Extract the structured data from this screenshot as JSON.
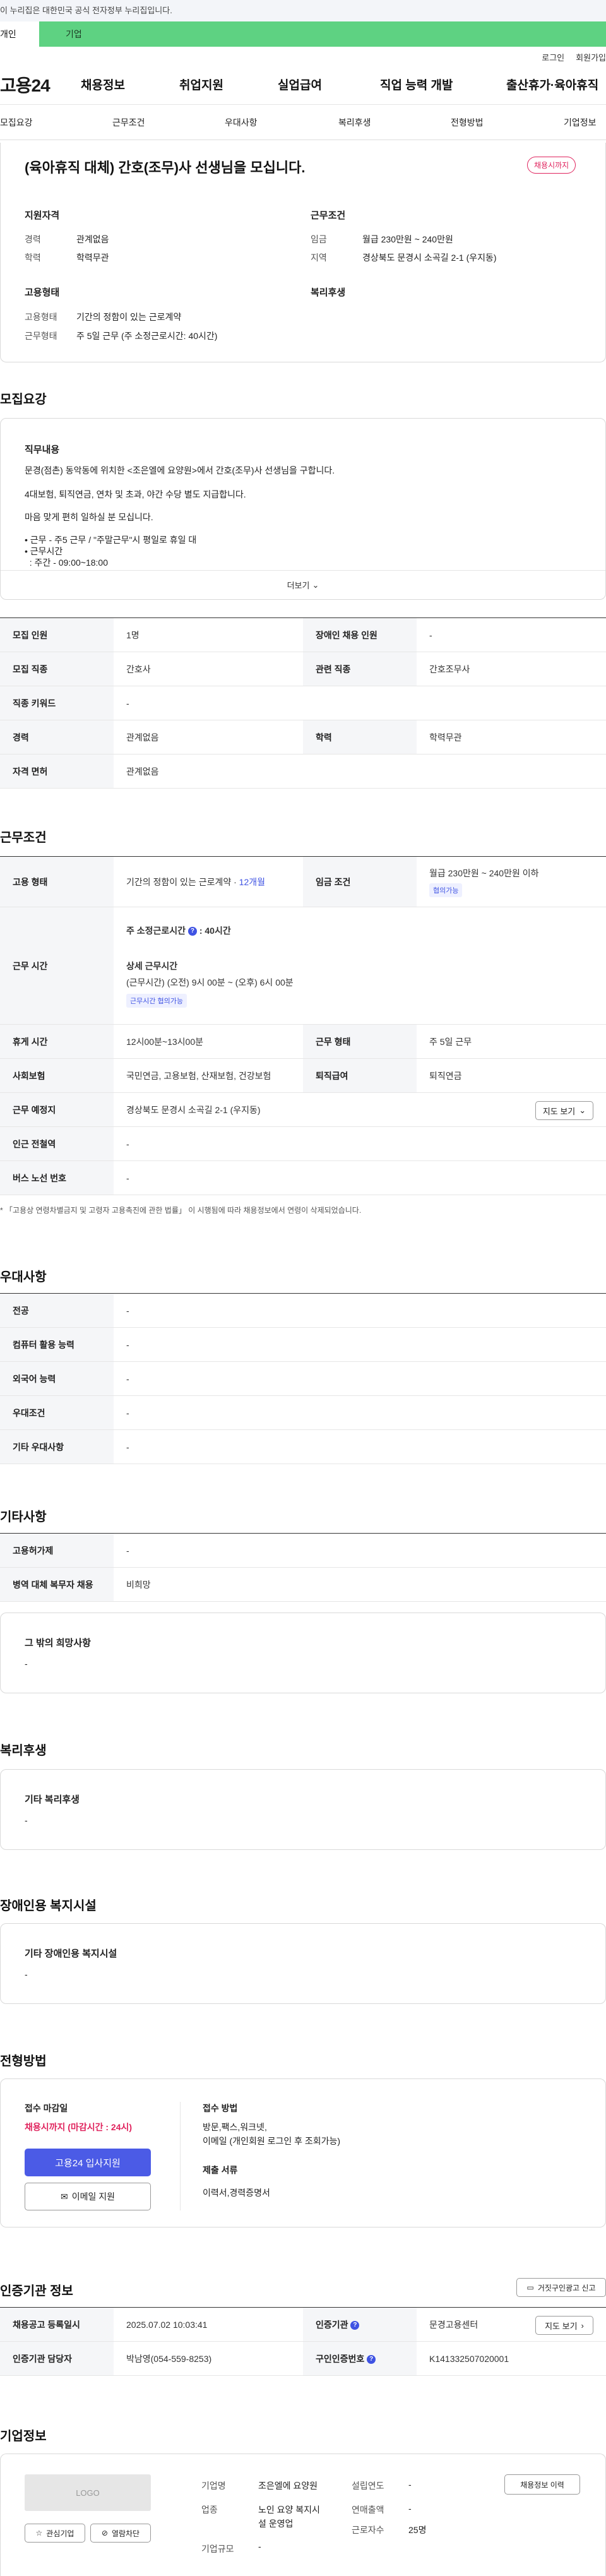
{
  "gov_banner": "이 누리집은 대한민국 공식 전자정부 누리집입니다.",
  "user_tabs": [
    "개인",
    "기업"
  ],
  "util": [
    "로그인",
    "회원가입"
  ],
  "logo": "고용24",
  "gnb": [
    "채용정보",
    "취업지원",
    "실업급여",
    "직업 능력 개발",
    "출산휴가·육아휴직"
  ],
  "tabs": [
    "모집요강",
    "근무조건",
    "우대사항",
    "복리후생",
    "전형방법",
    "기업정보"
  ],
  "summary": {
    "title": "(육아휴직 대체) 간호(조무)사 선생님을 모십니다.",
    "badge": "채용시까지",
    "left_heading": "지원자격",
    "right_heading": "근무조건",
    "career_label": "경력",
    "career_value": "관계없음",
    "edu_label": "학력",
    "edu_value": "학력무관",
    "wage_label": "임금",
    "wage_value": "월급 230만원 ~ 240만원",
    "region_label": "지역",
    "region_value": "경상북도 문경시 소곡길 2-1 (우지동)",
    "emp_heading": "고용형태",
    "welfare_heading": "복리후생",
    "emptype_label": "고용형태",
    "emptype_value": "기간의 정함이 있는 근로계약",
    "worktype_label": "근무형태",
    "worktype_value": "주 5일 근무 (주 소정근로시간: 40시간)"
  },
  "recruit": {
    "heading": "모집요강",
    "job_heading": "직무내용",
    "lines": [
      "문경(점촌) 동악동에 위치한 <조은엘에 요양원>에서 간호(조무)사 선생님을 구합니다.",
      "4대보험, 퇴직연금, 연차 및 초과, 야간 수당 별도 지급합니다.",
      "마음 맞게 편히 일하실 분 모십니다.",
      "• 근무 - 주5 근무 / \"주말근무\"시 평일로 휴일 대",
      "• 근무시간",
      "  : 주간 - 09:00~18:00"
    ],
    "more": "더보기",
    "rows": [
      {
        "k1": "모집 인원",
        "v1": "1명",
        "k2": "장애인 채용 인원",
        "v2": "-"
      },
      {
        "k1": "모집 직종",
        "v1": "간호사",
        "k2": "관련 직종",
        "v2": "간호조무사"
      },
      {
        "k1": "직종 키워드",
        "v1": "-"
      },
      {
        "k1": "경력",
        "v1": "관계없음",
        "k2": "학력",
        "v2": "학력무관"
      },
      {
        "k1": "자격 면허",
        "v1": "관계없음"
      }
    ]
  },
  "work": {
    "heading": "근무조건",
    "emp_label": "고용 형태",
    "emp_value": "기간의 정함이 있는 근로계약 · ",
    "emp_months": "12개월",
    "wage_label": "임금 조건",
    "wage_value": "월급 230만원 ~ 240만원 이하",
    "wage_chip": "협의가능",
    "hours_label": "근무 시간",
    "weekly": "주 소정근로시간",
    "weekly_val": ": 40시간",
    "detail_heading": "상세 근무시간",
    "detail_value": "(근무시간) (오전) 9시 00분 ~ (오후) 6시 00분",
    "detail_chip": "근무시간 협의가능",
    "break_label": "휴게 시간",
    "break_value": "12시00분~13시00분",
    "form_label": "근무 형태",
    "form_value": "주 5일 근무",
    "ins_label": "사회보험",
    "ins_value": "국민연금, 고용보험, 산재보험, 건강보험",
    "ret_label": "퇴직급여",
    "ret_value": "퇴직연금",
    "place_label": "근무 예정지",
    "place_value": "경상북도 문경시 소곡길 2-1 (우지동)",
    "map_btn": "지도 보기",
    "subway_label": "인근 전철역",
    "subway_value": "-",
    "bus_label": "버스 노선 번호",
    "bus_value": "-",
    "note": "* 「고용상 연령차별금지 및 고령자 고용촉진에 관한 법률」 이 시행됨에 따라 채용정보에서 연령이 삭제되었습니다."
  },
  "pref": {
    "heading": "우대사항",
    "rows": [
      {
        "k": "전공",
        "v": "-"
      },
      {
        "k": "컴퓨터 활용 능력",
        "v": "-"
      },
      {
        "k": "외국어 능력",
        "v": "-"
      },
      {
        "k": "우대조건",
        "v": "-"
      },
      {
        "k": "기타 우대사항",
        "v": "-"
      }
    ]
  },
  "etc": {
    "heading": "기타사항",
    "rows": [
      {
        "k": "고용허가제",
        "v": "-"
      },
      {
        "k": "병역 대체 복무자 채용",
        "v": "비희망"
      }
    ],
    "box_title": "그 밖의 희망사항",
    "box_value": "-"
  },
  "welfare": {
    "heading": "복리후생",
    "box_title": "기타 복리후생",
    "box_value": "-"
  },
  "disabled": {
    "heading": "장애인용 복지시설",
    "box_title": "기타 장애인용 복지시설",
    "box_value": "-"
  },
  "process": {
    "heading": "전형방법",
    "deadline_label": "접수 마감일",
    "deadline_value": "채용시까지 (마감시간 : 24시)",
    "apply_btn": "고용24 입사지원",
    "email_btn": "이메일 지원",
    "method_label": "접수 방법",
    "method_value_1": "방문,팩스,워크넷,",
    "method_value_2": "이메일 (개인회원 로그인 후 조회가능)",
    "docs_label": "제출 서류",
    "docs_value": "이력서,경력증명서"
  },
  "cert": {
    "heading": "인증기관 정보",
    "report_btn": "거짓구인광고 신고",
    "reg_label": "채용공고 등록일시",
    "reg_value": "2025.07.02 10:03:41",
    "org_label": "인증기관",
    "org_value": "문경고용센터",
    "map_btn": "지도 보기",
    "mgr_label": "인증기관 담당자",
    "mgr_value": "박남영(054-559-8253)",
    "num_label": "구인인증번호",
    "num_value": "K141332507020001"
  },
  "company": {
    "heading": "기업정보",
    "logo": "LOGO",
    "fav_btn": "관심기업",
    "block_btn": "열람차단",
    "name_label": "기업명",
    "name_value": "조은엘에 요양원",
    "biz_label": "업종",
    "biz_value_1": "노인 요양 복지시",
    "biz_value_2": "설 운영업",
    "scale_label": "기업규모",
    "scale_value": "-",
    "est_label": "설립연도",
    "est_value": "-",
    "sales_label": "연매출액",
    "sales_value": "-",
    "emp_label": "근로자수",
    "emp_value": "25명",
    "jobs_btn": "채용정보 이력"
  }
}
